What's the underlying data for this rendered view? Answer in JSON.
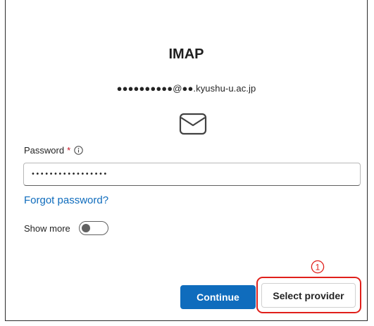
{
  "dialog": {
    "title": "IMAP",
    "email": "●●●●●●●●●●@●●.kyushu-u.ac.jp",
    "icon": "mail-icon"
  },
  "password": {
    "label": "Password",
    "required_mark": "*",
    "info_icon": "info-icon",
    "value": "•••••••••••••••••"
  },
  "links": {
    "forgot_password": "Forgot password?"
  },
  "show_more": {
    "label": "Show more",
    "toggle_state": "off"
  },
  "buttons": {
    "continue": "Continue",
    "select_provider": "Select provider"
  },
  "annotation": {
    "marker": "1",
    "color": "#e0201b"
  },
  "colors": {
    "accent": "#0f6cbd",
    "required": "#c50f1f",
    "annotation": "#e0201b"
  }
}
